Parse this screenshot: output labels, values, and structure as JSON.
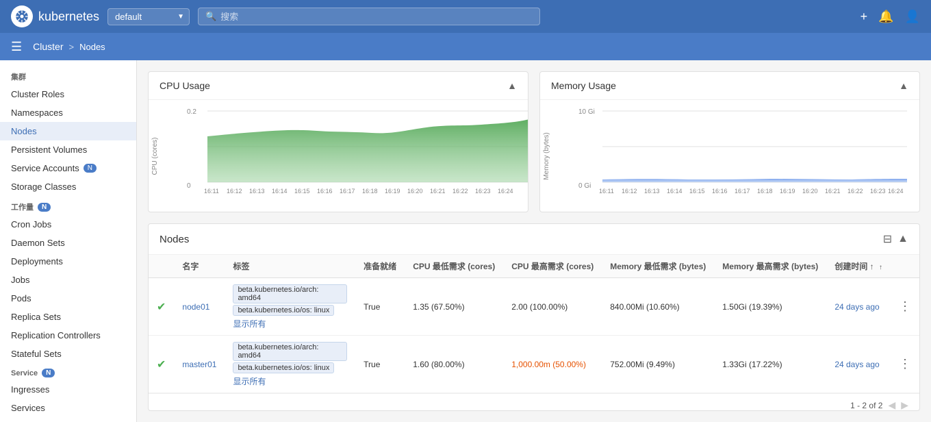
{
  "topNav": {
    "logoText": "kubernetes",
    "namespace": "default",
    "searchPlaceholder": "搜索",
    "addIcon": "+",
    "bellIcon": "🔔"
  },
  "breadcrumb": {
    "cluster": "Cluster",
    "separator": ">",
    "current": "Nodes"
  },
  "sidebar": {
    "section1Label": "集群",
    "items1": [
      {
        "label": "Cluster Roles",
        "active": false
      },
      {
        "label": "Namespaces",
        "active": false
      },
      {
        "label": "Nodes",
        "active": true
      },
      {
        "label": "Persistent Volumes",
        "active": false
      },
      {
        "label": "Service Accounts",
        "active": false,
        "badge": "N"
      },
      {
        "label": "Storage Classes",
        "active": false
      }
    ],
    "section2Label": "工作量",
    "section2Badge": "N",
    "items2": [
      {
        "label": "Cron Jobs",
        "active": false
      },
      {
        "label": "Daemon Sets",
        "active": false
      },
      {
        "label": "Deployments",
        "active": false
      },
      {
        "label": "Jobs",
        "active": false
      },
      {
        "label": "Pods",
        "active": false
      },
      {
        "label": "Replica Sets",
        "active": false
      },
      {
        "label": "Replication Controllers",
        "active": false
      },
      {
        "label": "Stateful Sets",
        "active": false
      }
    ],
    "section3Label": "Service",
    "section3Badge": "N",
    "items3": [
      {
        "label": "Ingresses",
        "active": false
      },
      {
        "label": "Services",
        "active": false
      }
    ]
  },
  "cpuChart": {
    "title": "CPU Usage",
    "yLabel": "CPU (cores)",
    "yMax": "0.2",
    "yMin": "0",
    "times": [
      "16:11",
      "16:12",
      "16:13",
      "16:14",
      "16:15",
      "16:16",
      "16:17",
      "16:18",
      "16:19",
      "16:20",
      "16:21",
      "16:22",
      "16:23",
      "16:24"
    ]
  },
  "memoryChart": {
    "title": "Memory Usage",
    "yLabel": "Memory (bytes)",
    "yMax": "10 Gi",
    "yMin": "0 Gi",
    "times": [
      "16:11",
      "16:12",
      "16:13",
      "16:14",
      "16:15",
      "16:16",
      "16:17",
      "16:18",
      "16:19",
      "16:20",
      "16:21",
      "16:22",
      "16:23",
      "16:24"
    ]
  },
  "nodesTable": {
    "title": "Nodes",
    "columns": [
      "名字",
      "标签",
      "准备就绪",
      "CPU 最低需求 (cores)",
      "CPU 最高需求 (cores)",
      "Memory 最低需求 (bytes)",
      "Memory 最高需求 (bytes)",
      "创建时间 ↑"
    ],
    "rows": [
      {
        "name": "node01",
        "tags": [
          "beta.kubernetes.io/arch: amd64",
          "beta.kubernetes.io/os: linux"
        ],
        "showAll": "显示所有",
        "ready": "True",
        "cpuMin": "1.35 (67.50%)",
        "cpuMax": "2.00 (100.00%)",
        "memMin": "840.00Mi (10.60%)",
        "memMax": "1.50Gi (19.39%)",
        "created": "24 days ago",
        "cpuMaxOrange": false
      },
      {
        "name": "master01",
        "tags": [
          "beta.kubernetes.io/arch: amd64",
          "beta.kubernetes.io/os: linux"
        ],
        "showAll": "显示所有",
        "ready": "True",
        "cpuMin": "1.60 (80.00%)",
        "cpuMax": "1,000.00m (50.00%)",
        "memMin": "752.00Mi (9.49%)",
        "memMax": "1.33Gi (17.22%)",
        "created": "24 days ago",
        "cpuMaxOrange": true
      }
    ],
    "pagination": "1 - 2 of 2"
  }
}
